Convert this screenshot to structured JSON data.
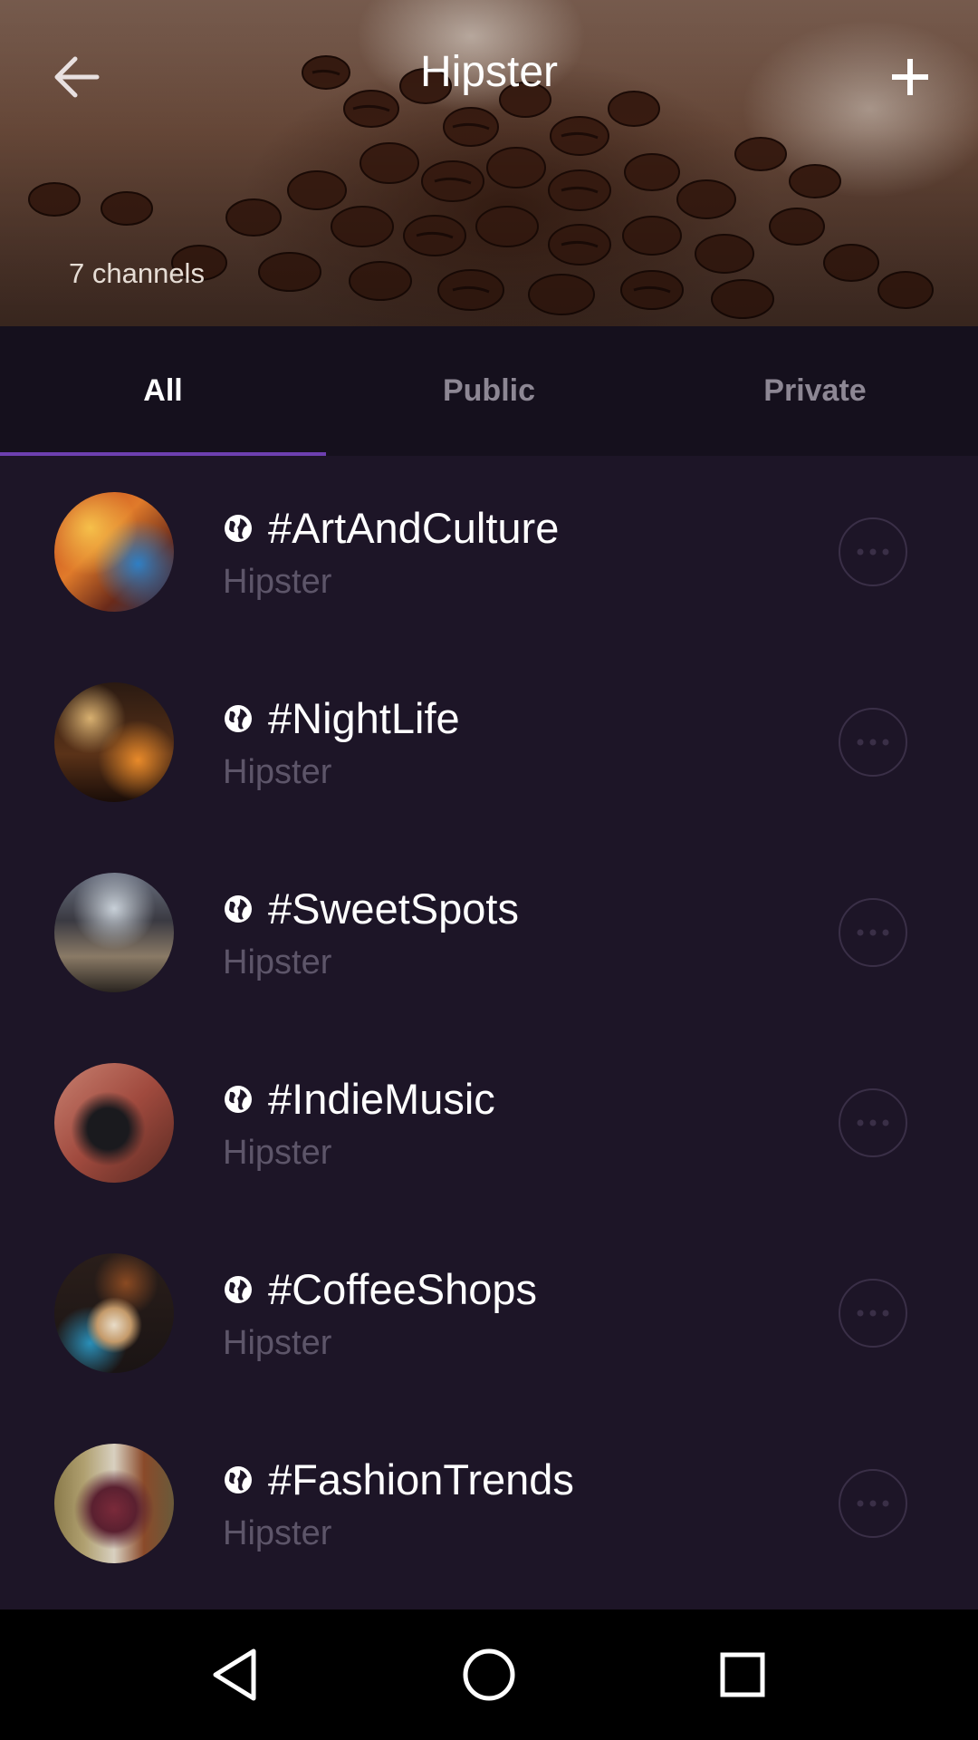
{
  "header": {
    "title": "Hipster",
    "channel_count": "7 channels",
    "back_icon": "arrow-left-icon",
    "add_icon": "plus-icon"
  },
  "tabs": [
    {
      "label": "All",
      "active": true
    },
    {
      "label": "Public",
      "active": false
    },
    {
      "label": "Private",
      "active": false
    }
  ],
  "channels": [
    {
      "name": "#ArtAndCulture",
      "group": "Hipster",
      "visibility": "public"
    },
    {
      "name": "#NightLife",
      "group": "Hipster",
      "visibility": "public"
    },
    {
      "name": "#SweetSpots",
      "group": "Hipster",
      "visibility": "public"
    },
    {
      "name": "#IndieMusic",
      "group": "Hipster",
      "visibility": "public"
    },
    {
      "name": "#CoffeeShops",
      "group": "Hipster",
      "visibility": "public"
    },
    {
      "name": "#FashionTrends",
      "group": "Hipster",
      "visibility": "public"
    }
  ],
  "colors": {
    "background": "#1d1527",
    "tab_bar": "#15101d",
    "accent": "#6d3fb0",
    "subtitle": "#5d5569"
  },
  "navbar": {
    "icons": [
      "nav-back-icon",
      "nav-home-icon",
      "nav-recents-icon"
    ]
  }
}
